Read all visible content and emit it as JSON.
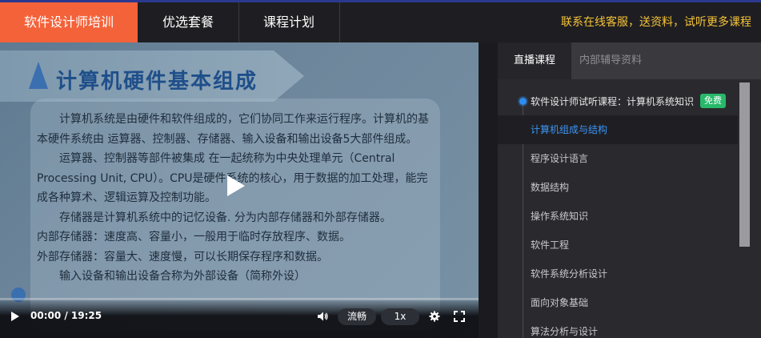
{
  "nav": {
    "tabs": [
      {
        "label": "软件设计师培训",
        "active": true
      },
      {
        "label": "优选套餐",
        "active": false
      },
      {
        "label": "课程计划",
        "active": false
      }
    ],
    "promo_text": "联系在线客服，送资料，试听更多课程"
  },
  "slide": {
    "title": "计算机硬件基本组成",
    "paragraphs": [
      "计算机系统是由硬件和软件组成的，它们协同工作来运行程序。计算机的基本硬件系统由 运算器、控制器、存储器、输入设备和输出设备5大部件组成。",
      "运算器、控制器等部件被集成 在一起统称为中央处理单元（Central Processing Unit, CPU）。CPU是硬件系统的核心，用于数据的加工处理，能完成各种算术、逻辑运算及控制功能。",
      "存储器是计算机系统中的记忆设备. 分为内部存储器和外部存储器。",
      "内部存储器：速度高、容量小，一般用于临时存放程序、数据。",
      "外部存储器：容量大、速度慢，可以长期保存程序和数据。",
      "输入设备和输出设备合称为外部设备（简称外设）"
    ]
  },
  "player": {
    "time": "00:00 / 19:25",
    "progress": 0,
    "quality_label": "流畅",
    "speed_label": "1x"
  },
  "sidebar": {
    "tabs": [
      {
        "label": "直播课程",
        "active": true
      },
      {
        "label": "内部辅导资料",
        "active": false
      }
    ],
    "course_title": "软件设计师试听课程：计算机系统知识",
    "course_badge": "免费",
    "items": [
      {
        "label": "计算机组成与结构",
        "active": true
      },
      {
        "label": "程序设计语言",
        "active": false
      },
      {
        "label": "数据结构",
        "active": false
      },
      {
        "label": "操作系统知识",
        "active": false
      },
      {
        "label": "软件工程",
        "active": false
      },
      {
        "label": "软件系统分析设计",
        "active": false
      },
      {
        "label": "面向对象基础",
        "active": false
      },
      {
        "label": "算法分析与设计",
        "active": false
      }
    ]
  },
  "colors": {
    "accent": "#f4623a",
    "promo": "#f6c338",
    "active_item": "#3d95f5",
    "badge": "#27b86a"
  }
}
